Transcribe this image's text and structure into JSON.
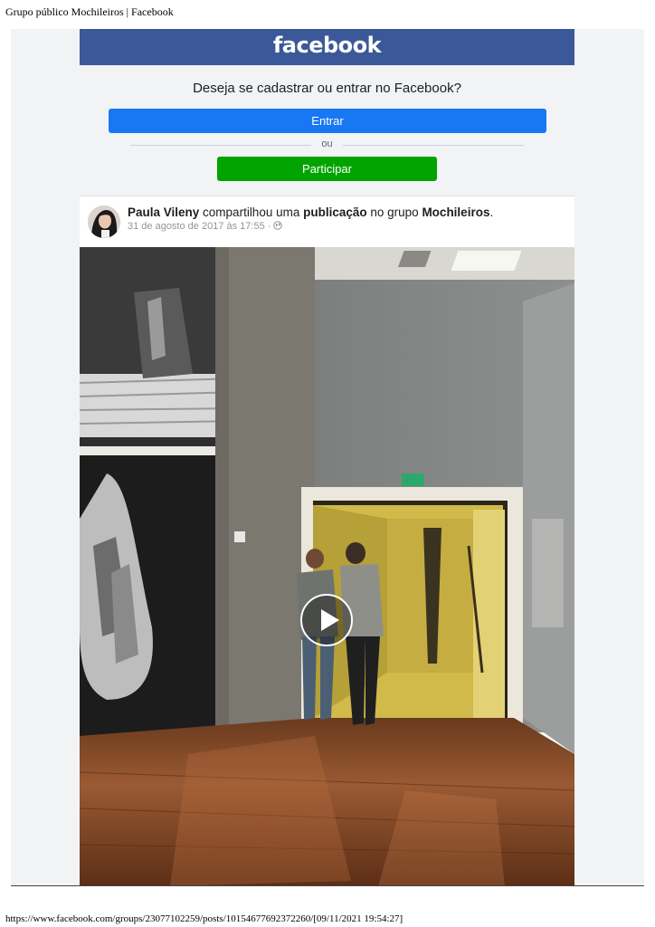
{
  "browser": {
    "page_title": "Grupo público Mochileiros | Facebook",
    "footer_url": "https://www.facebook.com/groups/23077102259/posts/10154677692372260/[09/11/2021 19:54:27]"
  },
  "header": {
    "logo_text": "facebook",
    "brand_color": "#3b5998"
  },
  "login_prompt": {
    "question": "Deseja se cadastrar ou entrar no Facebook?",
    "login_button": "Entrar",
    "divider_text": "ou",
    "signup_button": "Participar",
    "login_color": "#1877f2",
    "signup_color": "#00a400"
  },
  "post": {
    "author": "Paula Vileny",
    "action_text": " compartilhou uma ",
    "object_text": "publicação",
    "group_prefix": " no grupo ",
    "group_name": "Mochileiros",
    "end_punct": ".",
    "timestamp": "31 de agosto de 2017 às 17:55 · ",
    "privacy_icon": "globe-icon",
    "video_icon": "play-icon"
  }
}
